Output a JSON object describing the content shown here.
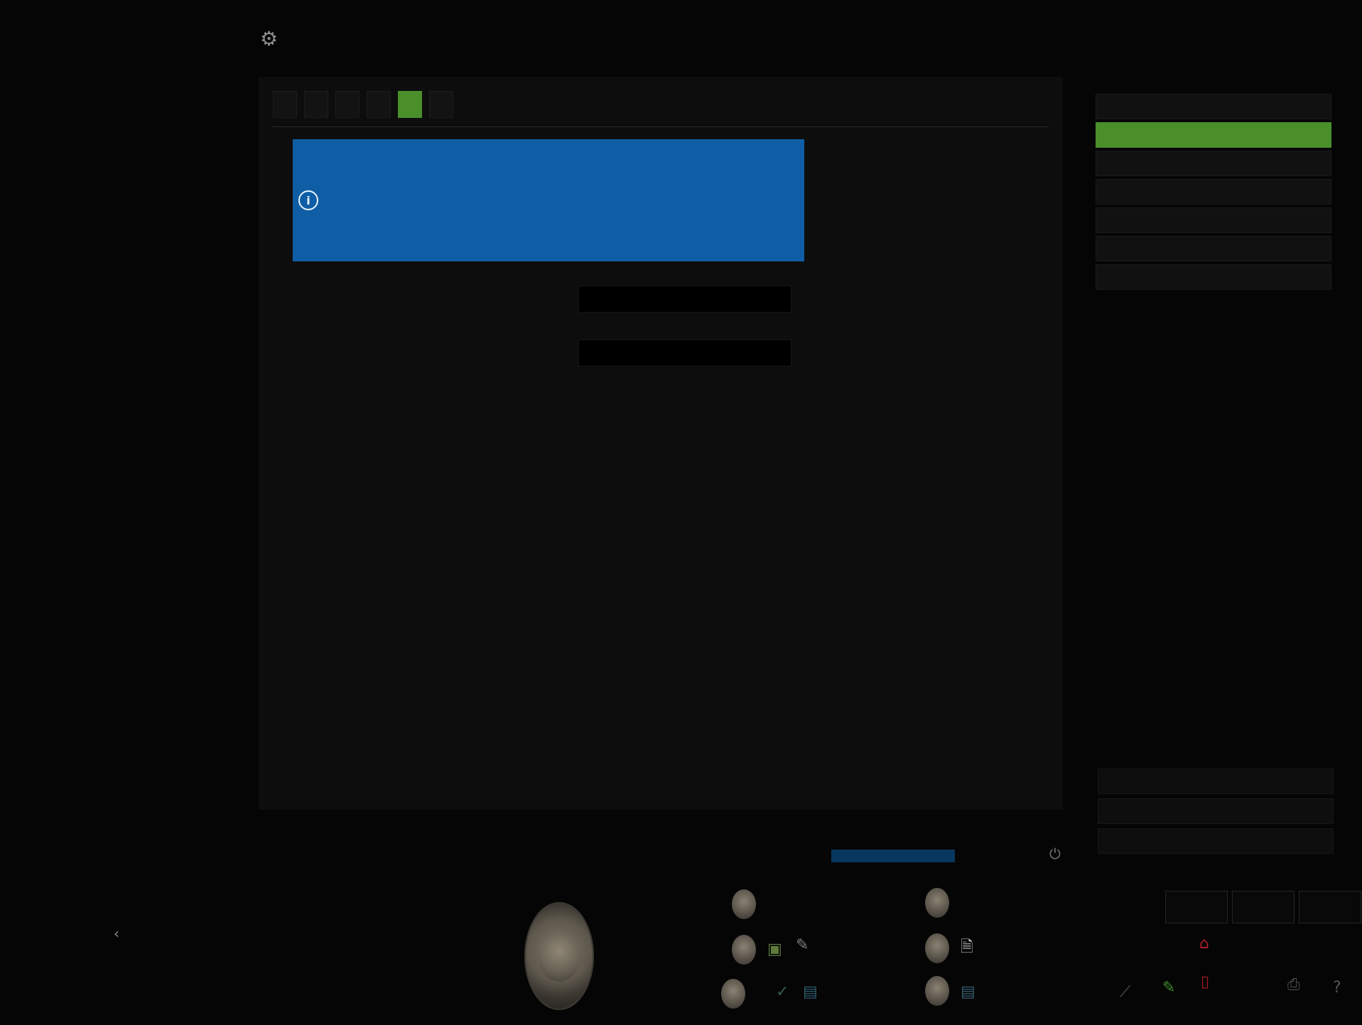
{
  "header": {
    "logo_label": "",
    "logo_icon": "gear-icon",
    "info_rows": [
      {
        "label": "",
        "value": ""
      },
      {
        "label": "",
        "value": ""
      },
      {
        "label": "",
        "value": ""
      }
    ],
    "page_title": ""
  },
  "main": {
    "tabs": [
      {
        "label": "",
        "active": false
      },
      {
        "label": "",
        "active": false
      },
      {
        "label": "",
        "active": false
      },
      {
        "label": "",
        "active": false
      },
      {
        "label": "",
        "active": true
      },
      {
        "label": "",
        "active": false
      }
    ],
    "info_box": {
      "icon": "info-circle-icon",
      "title": "",
      "description": ""
    },
    "fields": [
      {
        "label": "",
        "value": ""
      },
      {
        "label": "",
        "value": ""
      }
    ],
    "center_label": ""
  },
  "sidebar": {
    "items": [
      {
        "label": "",
        "active": false
      },
      {
        "label": "",
        "active": true
      },
      {
        "label": "",
        "active": false
      },
      {
        "label": "",
        "active": false
      },
      {
        "label": "",
        "active": false
      },
      {
        "label": "",
        "active": false
      },
      {
        "label": "",
        "active": false
      }
    ],
    "footer_buttons": [
      "",
      "",
      ""
    ]
  },
  "status_bar": {
    "left_status": "",
    "middle_status": "",
    "right_icon": "power-icon"
  },
  "control_surface": {
    "left_label": "",
    "left_icon": "arrow-left-icon",
    "knob_left_label": "",
    "knob_right_label": "",
    "knob_bottom_label": "",
    "left_cluster_icons": [
      "",
      "",
      "",
      "",
      ""
    ],
    "right_cluster_icons": [
      "",
      "",
      "",
      "",
      ""
    ],
    "tray_buttons": [
      "",
      "",
      ""
    ],
    "right_status_icons": [
      "",
      "",
      "",
      "",
      ""
    ]
  },
  "colors": {
    "active_green": "#4a8f2a",
    "info_blue": "#0f5ea5",
    "status_blue": "#07365f"
  }
}
